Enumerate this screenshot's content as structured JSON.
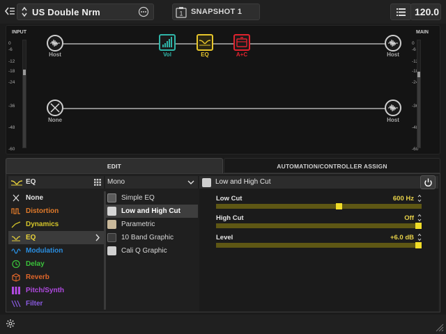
{
  "header": {
    "preset_name": "US Double Nrm",
    "snapshot_label": "SNAPSHOT 1",
    "tempo": "120.0"
  },
  "chain": {
    "input_label": "INPUT",
    "main_label": "MAIN",
    "input_ticks": [
      "0",
      "-6",
      "-12",
      "-18",
      "-24",
      "-36",
      "-48",
      "-60"
    ],
    "main_ticks": [
      "0",
      "-6",
      "-12",
      "-18",
      "-24",
      "-36",
      "-48",
      "-60"
    ],
    "input_level": 0.7,
    "main_level": 0.68,
    "path1": {
      "input": "Host",
      "output": "Host",
      "blocks": [
        {
          "label": "Vol",
          "color": "#2fb5a8",
          "icon": "volume-icon"
        },
        {
          "label": "EQ",
          "color": "#e7c62b",
          "icon": "eq-icon"
        },
        {
          "label": "A+C",
          "color": "#e0232e",
          "icon": "amp-icon"
        }
      ]
    },
    "path2": {
      "input": "None",
      "output": "Host"
    }
  },
  "tabs": {
    "edit": "EDIT",
    "automation": "AUTOMATION/CONTROLLER ASSIGN"
  },
  "categories": {
    "header": "EQ",
    "items": [
      {
        "label": "None",
        "color": "#d8d8d8",
        "icon": "none-icon"
      },
      {
        "label": "Distortion",
        "color": "#e07a2a",
        "icon": "distortion-icon"
      },
      {
        "label": "Dynamics",
        "color": "#d4c52a",
        "icon": "dynamics-icon"
      },
      {
        "label": "EQ",
        "color": "#e8d23a",
        "icon": "eq-icon"
      },
      {
        "label": "Modulation",
        "color": "#2a8ee0",
        "icon": "modulation-icon"
      },
      {
        "label": "Delay",
        "color": "#3ac23a",
        "icon": "delay-icon"
      },
      {
        "label": "Reverb",
        "color": "#e0662a",
        "icon": "reverb-icon"
      },
      {
        "label": "Pitch/Synth",
        "color": "#b04ae0",
        "icon": "pitch-icon"
      },
      {
        "label": "Filter",
        "color": "#8a5ae0",
        "icon": "filter-icon"
      }
    ]
  },
  "models": {
    "header": "Mono",
    "items": [
      {
        "label": "Simple EQ"
      },
      {
        "label": "Low and High Cut"
      },
      {
        "label": "Parametric"
      },
      {
        "label": "10 Band Graphic"
      },
      {
        "label": "Cali Q Graphic"
      }
    ]
  },
  "params": {
    "title": "Low and High Cut",
    "rows": [
      {
        "name": "Low Cut",
        "value": "600 Hz",
        "level": 0.6
      },
      {
        "name": "High Cut",
        "value": "Off",
        "level": 1.0
      },
      {
        "name": "Level",
        "value": "+6.0 dB",
        "level": 1.0
      }
    ]
  }
}
